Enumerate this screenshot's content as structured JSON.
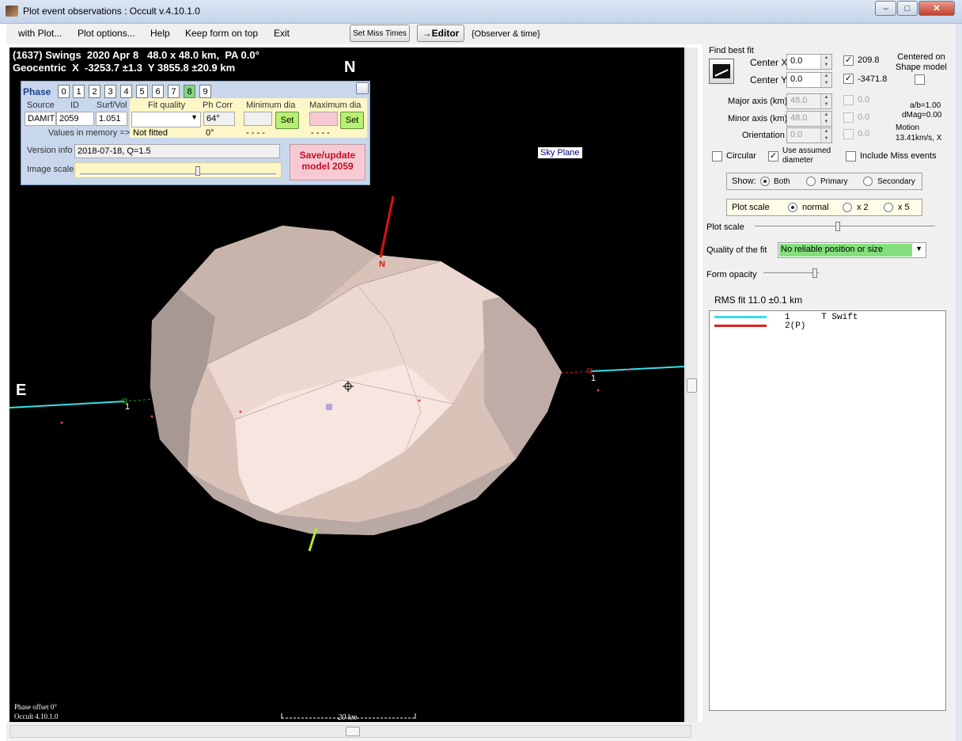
{
  "window": {
    "title": "Plot event observations : Occult v.4.10.1.0",
    "min": "–",
    "max": "□",
    "close": "✕"
  },
  "menu": {
    "items": [
      "with Plot...",
      "Plot options...",
      "Help",
      "Keep form on top",
      "Exit"
    ],
    "set_miss_times": "Set Miss Times",
    "editor": "→Editor",
    "observer_time": "{Observer & time}"
  },
  "plot": {
    "header_line1": "(1637) Swings  2020 Apr 8   48.0 x 48.0 km,  PA 0.0°",
    "header_line2": "Geocentric  X  -3253.7 ±1.3  Y 3855.8 ±20.9 km",
    "north": "N",
    "east": "E",
    "sky_plane": "Sky Plane",
    "pole_label": "N",
    "chord1_left": "1",
    "chord1_right": "1",
    "chord2": "2",
    "phase_offset": "Phase offset 0°",
    "version": "Occult 4.10.1.0",
    "scale_bar": "20 km"
  },
  "phase_panel": {
    "title": "Phase",
    "phases": [
      "0",
      "1",
      "2",
      "3",
      "4",
      "5",
      "6",
      "7",
      "8",
      "9"
    ],
    "selected_phase": "8",
    "headers": {
      "source": "Source",
      "id": "ID",
      "surf_vol": "Surf/Vol",
      "fit_quality": "Fit quality",
      "ph_corr": "Ph Corr",
      "min_dia": "Minimum dia",
      "max_dia": "Maximum dia"
    },
    "source": "DAMIT",
    "id": "2059",
    "surf_vol": "1.051",
    "ph_corr": "64°",
    "memory_label": "Values in memory =>",
    "not_fitted": "Not fitted",
    "mem_ph_corr": "0°",
    "mem_min": "- - - -",
    "mem_max": "- - - -",
    "set_label": "Set",
    "version_label": "Version info",
    "version_value": "2018-07-18, Q=1.5",
    "image_scale_label": "Image scale",
    "save_button": "Save/update\nmodel 2059"
  },
  "fit": {
    "find_best_fit": "Find best fit",
    "center_x_label": "Center X",
    "center_x": "0.0",
    "center_y_label": "Center Y",
    "center_y": "0.0",
    "x_value": "209.8",
    "y_value": "-3471.8",
    "centered_on": "Centered on\nShape model",
    "major_label": "Major axis (km)",
    "major": "48.0",
    "major_chk": "0.0",
    "minor_label": "Minor axis (km)",
    "minor": "48.0",
    "minor_chk": "0.0",
    "orient_label": "Orientation",
    "orient": "0.0",
    "orient_chk": "0.0",
    "ab": "a/b=1.00",
    "dmag": "dMag=0.00",
    "motion": "Motion\n13.41km/s, X",
    "circular": "Circular",
    "use_assumed": "Use assumed\ndiameter",
    "include_miss": "Include Miss events",
    "show_label": "Show:",
    "show_options": [
      "Both",
      "Primary",
      "Secondary"
    ],
    "plot_scale_group": "Plot scale",
    "scale_options": [
      "normal",
      "x 2",
      "x 5"
    ],
    "plot_scale_label": "Plot scale",
    "quality_label": "Quality of the fit",
    "quality_value": "No reliable position or size",
    "form_opacity": "Form opacity",
    "rms": "RMS fit 11.0 ±0.1 km"
  },
  "legend": {
    "rows": [
      {
        "label": "1      T Swift",
        "color": "#35e0ea"
      },
      {
        "label": "2(P)",
        "color": "#e02020"
      }
    ]
  },
  "colors": {
    "chord": "#35e0ea",
    "pole": "#e01010",
    "south_pole": "#b6e636",
    "asteroid": "#d9c3b8",
    "quality_bg": "#84e07c",
    "save_bg": "#f7c9d2"
  }
}
